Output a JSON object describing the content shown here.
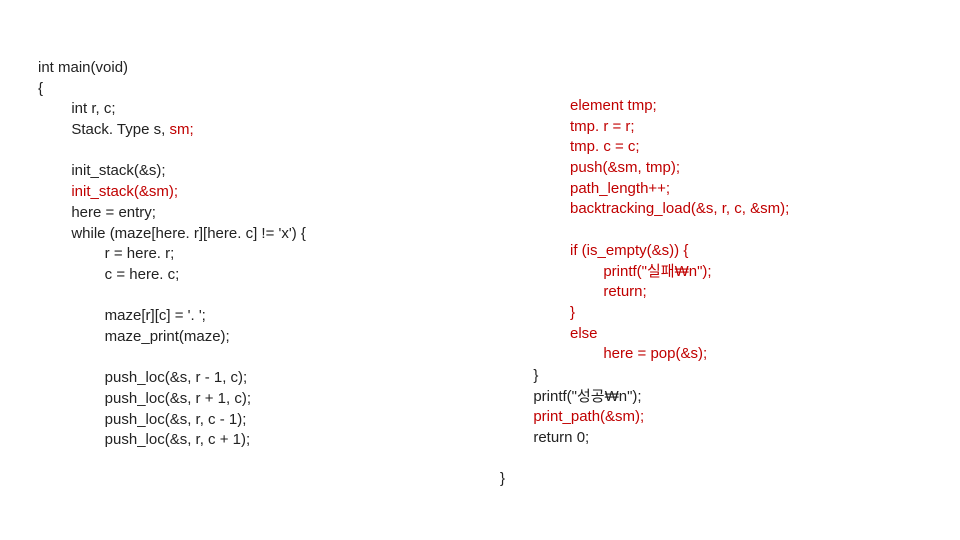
{
  "left": {
    "l1": "int main(void)",
    "l2": "{",
    "l3": "        int r, c;",
    "l4a": "        Stack. Type s, ",
    "l4b": "sm;",
    "l5": "",
    "l6": "        init_stack(&s);",
    "l7": "        init_stack(&sm);",
    "l8": "        here = entry;",
    "l9": "        while (maze[here. r][here. c] != 'x') {",
    "l10": "                r = here. r;",
    "l11": "                c = here. c;",
    "l12": "",
    "l13": "                maze[r][c] = '. ';",
    "l14": "                maze_print(maze);",
    "l15": "",
    "l16": "                push_loc(&s, r - 1, c);",
    "l17": "                push_loc(&s, r + 1, c);",
    "l18": "                push_loc(&s, r, c - 1);",
    "l19": "                push_loc(&s, r, c + 1);"
  },
  "right": {
    "r1": "element tmp;",
    "r2": "tmp. r = r;",
    "r3": "tmp. c = c;",
    "r4": "push(&sm, tmp);",
    "r5": "path_length++;",
    "r6": "backtracking_load(&s, r, c, &sm);",
    "r7": "",
    "r8": "if (is_empty(&s)) {",
    "r9": "        printf(\"실패₩n\");",
    "r10": "        return;",
    "r11": "}",
    "r12": "else",
    "r13": "        here = pop(&s);"
  },
  "bottom": {
    "b1": "        }",
    "b2": "        printf(\"성공₩n\");",
    "b3": "        print_path(&sm);",
    "b4": "        return 0;"
  },
  "close": "}"
}
